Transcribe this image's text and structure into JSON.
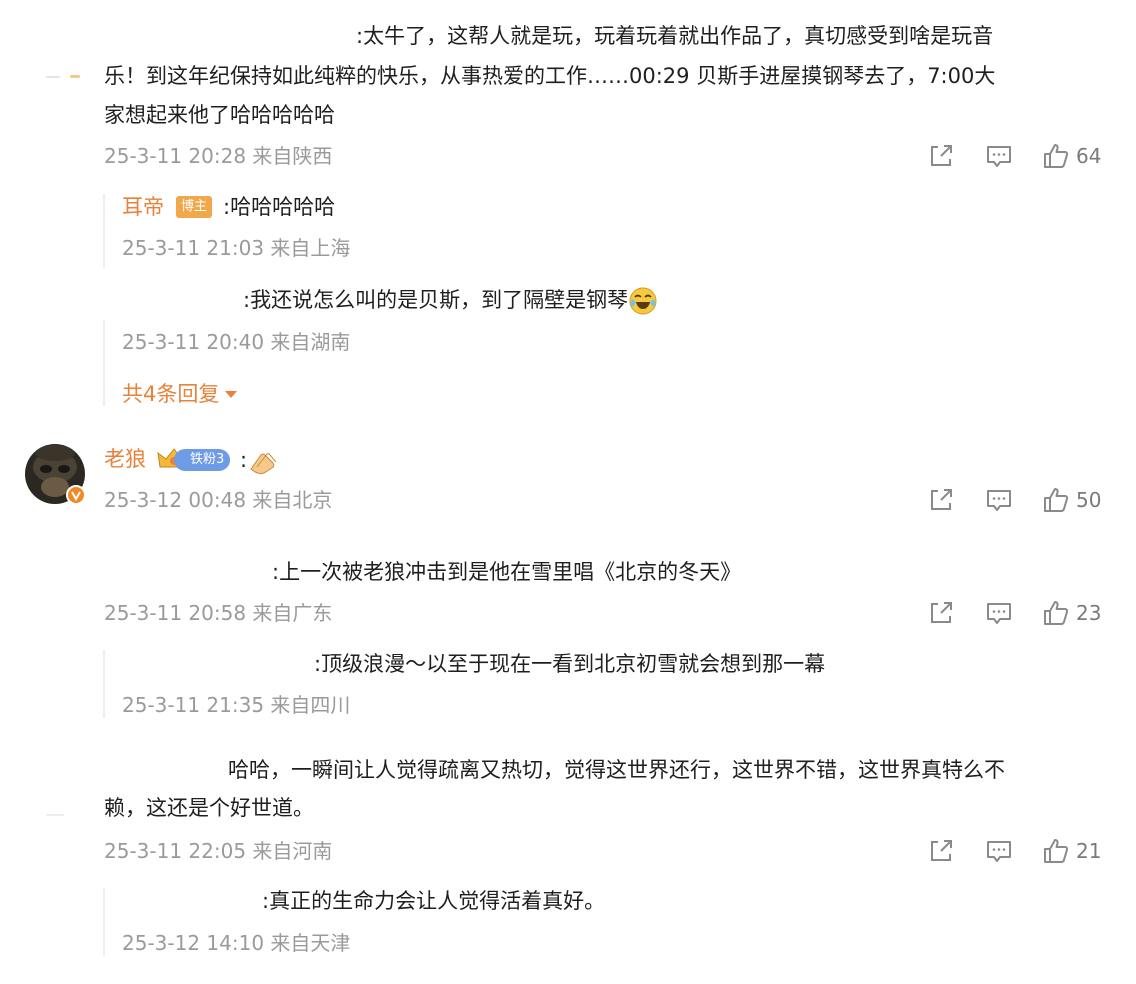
{
  "comment1": {
    "text_line1": ":太牛了，这帮人就是玩，玩着玩着就出作品了，真切感受到啥是玩音",
    "text_line2": "乐！到这年纪保持如此纯粹的快乐，从事热爱的工作……00:29 贝斯手进屋摸钢琴去了，7:00大",
    "text_line3": "家想起来他了哈哈哈哈哈",
    "meta": "25-3-11 20:28 来自陕西",
    "likes": "64",
    "replies": [
      {
        "name": "耳帝",
        "badge": "博主",
        "text": ":哈哈哈哈哈",
        "meta": "25-3-11 21:03 来自上海"
      },
      {
        "text": ":我还说怎么叫的是贝斯，到了隔壁是钢琴",
        "meta": "25-3-11 20:40 来自湖南"
      }
    ],
    "more_replies": "共4条回复"
  },
  "comment2": {
    "name": "老狼",
    "fan_badge": "铁粉3",
    "text": ":",
    "meta": "25-3-12 00:48 来自北京",
    "likes": "50"
  },
  "comment3": {
    "text": ":上一次被老狼冲击到是他在雪里唱《北京的冬天》",
    "meta": "25-3-11 20:58 来自广东",
    "likes": "23",
    "reply": {
      "text": ":顶级浪漫～以至于现在一看到北京初雪就会想到那一幕",
      "meta": "25-3-11 21:35 来自四川"
    }
  },
  "comment4": {
    "text_line1": "哈哈，一瞬间让人觉得疏离又热切，觉得这世界还行，这世界不错，这世界真特么不",
    "text_line2": "赖，这还是个好世道。",
    "meta": "25-3-11 22:05 来自河南",
    "likes": "21",
    "reply": {
      "text": ":真正的生命力会让人觉得活着真好。",
      "meta": "25-3-12 14:10 来自天津"
    }
  },
  "colors": {
    "accent": "#e8823a",
    "meta": "#9a9a9a",
    "badge_host": "#f0a84a",
    "badge_fan": "#6e9be6"
  },
  "icons": [
    "share-icon",
    "comment-icon",
    "like-icon",
    "chevron-down-icon",
    "verified-icon",
    "crown-icon",
    "laugh-cry-emoji",
    "clap-emoji"
  ]
}
